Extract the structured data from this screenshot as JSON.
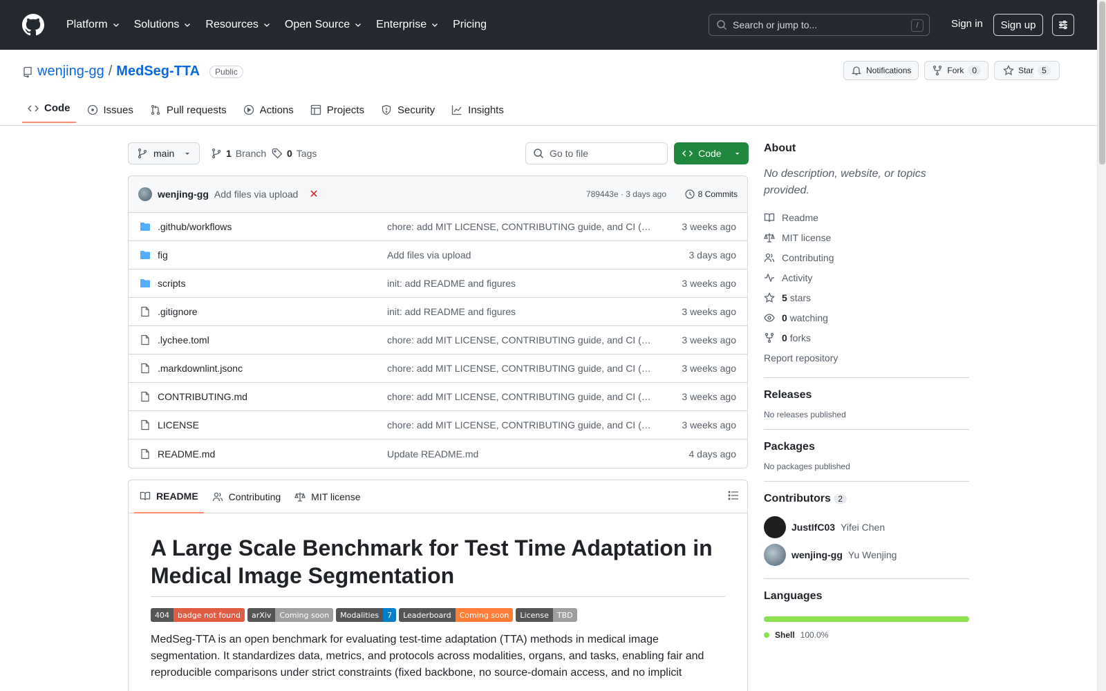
{
  "header": {
    "nav": [
      "Platform",
      "Solutions",
      "Resources",
      "Open Source",
      "Enterprise",
      "Pricing"
    ],
    "search_placeholder": "Search or jump to...",
    "search_shortcut": "/",
    "sign_in": "Sign in",
    "sign_up": "Sign up"
  },
  "repo": {
    "owner": "wenjing-gg",
    "separator": "/",
    "name": "MedSeg-TTA",
    "visibility": "Public",
    "notifications": "Notifications",
    "fork_label": "Fork",
    "fork_count": "0",
    "star_label": "Star",
    "star_count": "5"
  },
  "tabs": [
    "Code",
    "Issues",
    "Pull requests",
    "Actions",
    "Projects",
    "Security",
    "Insights"
  ],
  "branch": {
    "current": "main",
    "branch_count": "1",
    "branch_label": "Branch",
    "tag_count": "0",
    "tag_label": "Tags",
    "goto_placeholder": "Go to file",
    "code_button": "Code"
  },
  "latest_commit": {
    "author": "wenjing-gg",
    "message": "Add files via upload",
    "status": "✕",
    "hash_time": "789443e · 3 days ago",
    "commits": "8 Commits"
  },
  "files": [
    {
      "type": "dir",
      "name": ".github/workflows",
      "message": "chore: add MIT LICENSE, CONTRIBUTING guide, and CI (…",
      "age": "3 weeks ago"
    },
    {
      "type": "dir",
      "name": "fig",
      "message": "Add files via upload",
      "age": "3 days ago"
    },
    {
      "type": "dir",
      "name": "scripts",
      "message": "init: add README and figures",
      "age": "3 weeks ago"
    },
    {
      "type": "file",
      "name": ".gitignore",
      "message": "init: add README and figures",
      "age": "3 weeks ago"
    },
    {
      "type": "file",
      "name": ".lychee.toml",
      "message": "chore: add MIT LICENSE, CONTRIBUTING guide, and CI (…",
      "age": "3 weeks ago"
    },
    {
      "type": "file",
      "name": ".markdownlint.jsonc",
      "message": "chore: add MIT LICENSE, CONTRIBUTING guide, and CI (…",
      "age": "3 weeks ago"
    },
    {
      "type": "file",
      "name": "CONTRIBUTING.md",
      "message": "chore: add MIT LICENSE, CONTRIBUTING guide, and CI (…",
      "age": "3 weeks ago"
    },
    {
      "type": "file",
      "name": "LICENSE",
      "message": "chore: add MIT LICENSE, CONTRIBUTING guide, and CI (…",
      "age": "3 weeks ago"
    },
    {
      "type": "file",
      "name": "README.md",
      "message": "Update README.md",
      "age": "4 days ago"
    }
  ],
  "readme": {
    "tabs": [
      "README",
      "Contributing",
      "MIT license"
    ],
    "title": "A Large Scale Benchmark for Test Time Adaptation in Medical Image Segmentation",
    "shields": [
      {
        "left": "404",
        "right": "badge not found",
        "color": "#e05d44"
      },
      {
        "left": "arXiv",
        "right": "Coming soon",
        "color": "#9f9f9f"
      },
      {
        "left": "Modalities",
        "right": "7",
        "color": "#007ec6"
      },
      {
        "left": "Leaderboard",
        "right": "Coming soon",
        "color": "#fe7d37"
      },
      {
        "left": "License",
        "right": "TBD",
        "color": "#9f9f9f"
      }
    ],
    "intro": "MedSeg-TTA is an open benchmark for evaluating test-time adaptation (TTA) methods in medical image segmentation. It standardizes data, metrics, and protocols across modalities, organs, and tasks, enabling fair and reproducible comparisons under strict constraints (fixed backbone, no source-domain access, and no implicit"
  },
  "about": {
    "heading": "About",
    "description": "No description, website, or topics provided.",
    "items": [
      {
        "icon": "book-icon",
        "label": "Readme",
        "bold": ""
      },
      {
        "icon": "law-icon",
        "label": "MIT license",
        "bold": ""
      },
      {
        "icon": "people-icon",
        "label": "Contributing",
        "bold": ""
      },
      {
        "icon": "pulse-icon",
        "label": "Activity",
        "bold": ""
      },
      {
        "icon": "star-icon",
        "label": "stars",
        "bold": "5"
      },
      {
        "icon": "eye-icon",
        "label": "watching",
        "bold": "0"
      },
      {
        "icon": "fork-icon",
        "label": "forks",
        "bold": "0"
      }
    ],
    "report": "Report repository"
  },
  "releases": {
    "heading": "Releases",
    "text": "No releases published"
  },
  "packages": {
    "heading": "Packages",
    "text": "No packages published"
  },
  "contributors": {
    "heading": "Contributors",
    "count": "2",
    "people": [
      {
        "login": "JustIfC03",
        "name": "Yifei Chen"
      },
      {
        "login": "wenjing-gg",
        "name": "Yu Wenjing"
      }
    ]
  },
  "languages": {
    "heading": "Languages",
    "items": [
      {
        "name": "Shell",
        "percent": "100.0%",
        "color": "#89e051",
        "share": 1.0
      }
    ]
  }
}
